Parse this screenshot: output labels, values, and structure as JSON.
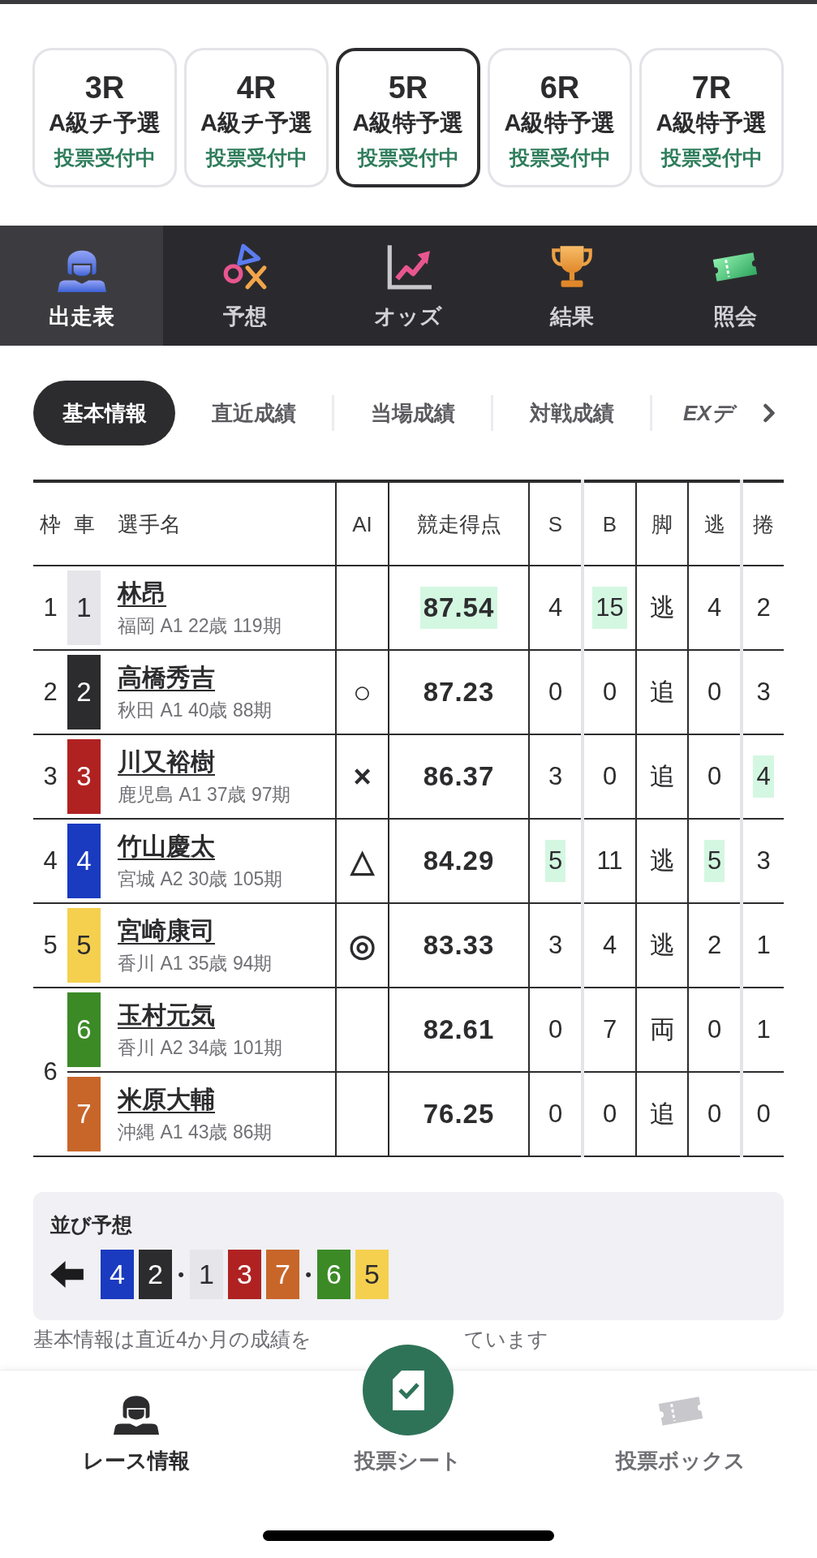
{
  "race_tabs": [
    {
      "race": "3R",
      "class": "A級チ予選",
      "status": "投票受付中",
      "selected": false
    },
    {
      "race": "4R",
      "class": "A級チ予選",
      "status": "投票受付中",
      "selected": false
    },
    {
      "race": "5R",
      "class": "A級特予選",
      "status": "投票受付中",
      "selected": true
    },
    {
      "race": "6R",
      "class": "A級特予選",
      "status": "投票受付中",
      "selected": false
    },
    {
      "race": "7R",
      "class": "A級特予選",
      "status": "投票受付中",
      "selected": false
    }
  ],
  "menu_tabs": [
    {
      "kind": "racecard",
      "label": "出走表",
      "selected": true
    },
    {
      "kind": "prediction",
      "label": "予想",
      "selected": false
    },
    {
      "kind": "odds",
      "label": "オッズ",
      "selected": false
    },
    {
      "kind": "results",
      "label": "結果",
      "selected": false
    },
    {
      "kind": "inquiry",
      "label": "照会",
      "selected": false
    }
  ],
  "info_tabs": [
    {
      "kind": "label",
      "label": "基本情報",
      "selected": true
    },
    {
      "kind": "label",
      "label": "直近成績",
      "selected": false
    },
    {
      "kind": "label",
      "label": "当場成績",
      "selected": false
    },
    {
      "kind": "label",
      "label": "対戦成績",
      "selected": false
    },
    {
      "kind": "logo",
      "label": "EXデ",
      "selected": false
    }
  ],
  "entry_table": {
    "columns": [
      "枠",
      "車",
      "選手名",
      "AI",
      "競走得点",
      "S",
      "B",
      "脚",
      "逃",
      "捲"
    ],
    "brackets": [
      {
        "number": "1",
        "cars": [
          {
            "number": "1",
            "color": "#e5e5ea",
            "name": "林昂",
            "profile": "福岡 A1 22歳 119期",
            "score": {
              "text": "87.54",
              "highlighted": true
            },
            "s": {
              "text": "4",
              "highlighted": false
            },
            "b": {
              "text": "15",
              "highlighted": true
            },
            "leg": "逃",
            "escape": {
              "text": "4",
              "highlighted": false
            },
            "sweep": {
              "text": "2",
              "highlighted": false
            }
          }
        ]
      },
      {
        "number": "2",
        "cars": [
          {
            "number": "2",
            "color": "#2c2c2e",
            "name": "高橋秀吉",
            "profile": "秋田 A1 40歳 88期",
            "ai_mark": "○",
            "score": {
              "text": "87.23",
              "highlighted": false
            },
            "s": {
              "text": "0",
              "highlighted": false
            },
            "b": {
              "text": "0",
              "highlighted": false
            },
            "leg": "追",
            "escape": {
              "text": "0",
              "highlighted": false
            },
            "sweep": {
              "text": "3",
              "highlighted": false
            }
          }
        ]
      },
      {
        "number": "3",
        "cars": [
          {
            "number": "3",
            "color": "#b02222",
            "name": "川又裕樹",
            "profile": "鹿児島 A1 37歳 97期",
            "ai_mark": "×",
            "score": {
              "text": "86.37",
              "highlighted": false
            },
            "s": {
              "text": "3",
              "highlighted": false
            },
            "b": {
              "text": "0",
              "highlighted": false
            },
            "leg": "追",
            "escape": {
              "text": "0",
              "highlighted": false
            },
            "sweep": {
              "text": "4",
              "highlighted": true
            }
          }
        ]
      },
      {
        "number": "4",
        "cars": [
          {
            "number": "4",
            "color": "#1a3ac0",
            "name": "竹山慶太",
            "profile": "宮城 A2 30歳 105期",
            "ai_mark": "△",
            "score": {
              "text": "84.29",
              "highlighted": false
            },
            "s": {
              "text": "5",
              "highlighted": true
            },
            "b": {
              "text": "11",
              "highlighted": false
            },
            "leg": "逃",
            "escape": {
              "text": "5",
              "highlighted": true
            },
            "sweep": {
              "text": "3",
              "highlighted": false
            }
          }
        ]
      },
      {
        "number": "5",
        "cars": [
          {
            "number": "5",
            "color": "#f5d04f",
            "name": "宮崎康司",
            "profile": "香川 A1 35歳 94期",
            "ai_mark": "◎",
            "score": {
              "text": "83.33",
              "highlighted": false
            },
            "s": {
              "text": "3",
              "highlighted": false
            },
            "b": {
              "text": "4",
              "highlighted": false
            },
            "leg": "逃",
            "escape": {
              "text": "2",
              "highlighted": false
            },
            "sweep": {
              "text": "1",
              "highlighted": false
            }
          }
        ]
      },
      {
        "number": "6",
        "cars": [
          {
            "number": "6",
            "color": "#3b8a26",
            "name": "玉村元気",
            "profile": "香川 A2 34歳 101期",
            "score": {
              "text": "82.61",
              "highlighted": false
            },
            "s": {
              "text": "0",
              "highlighted": false
            },
            "b": {
              "text": "7",
              "highlighted": false
            },
            "leg": "両",
            "escape": {
              "text": "0",
              "highlighted": false
            },
            "sweep": {
              "text": "1",
              "highlighted": false
            }
          },
          {
            "number": "7",
            "color": "#c8662a",
            "name": "米原大輔",
            "profile": "沖縄 A1 43歳 86期",
            "score": {
              "text": "76.25",
              "highlighted": false
            },
            "s": {
              "text": "0",
              "highlighted": false
            },
            "b": {
              "text": "0",
              "highlighted": false
            },
            "leg": "追",
            "escape": {
              "text": "0",
              "highlighted": false
            },
            "sweep": {
              "text": "0",
              "highlighted": false
            }
          }
        ]
      }
    ]
  },
  "line_prediction": {
    "title": "並び予想",
    "sequence": [
      {
        "kind": "car",
        "number": "4",
        "color": "#1a3ac0"
      },
      {
        "kind": "car",
        "number": "2",
        "color": "#2c2c2e"
      },
      {
        "kind": "separator",
        "text": "•"
      },
      {
        "kind": "car",
        "number": "1",
        "color": "#e5e5ea"
      },
      {
        "kind": "car",
        "number": "3",
        "color": "#b02222"
      },
      {
        "kind": "car",
        "number": "7",
        "color": "#c8662a"
      },
      {
        "kind": "separator",
        "text": "•"
      },
      {
        "kind": "car",
        "number": "6",
        "color": "#3b8a26"
      },
      {
        "kind": "car",
        "number": "5",
        "color": "#f5d04f"
      }
    ]
  },
  "footnote": {
    "before_button": "基本情報は直近4か月の成績を",
    "after_button": "ています"
  },
  "bottom_nav": [
    {
      "kind": "race_info",
      "label": "レース情報",
      "selected": true
    },
    {
      "kind": "bet_sheet",
      "label": "投票シート",
      "selected": false
    },
    {
      "kind": "bet_box",
      "label": "投票ボックス",
      "selected": false
    }
  ]
}
